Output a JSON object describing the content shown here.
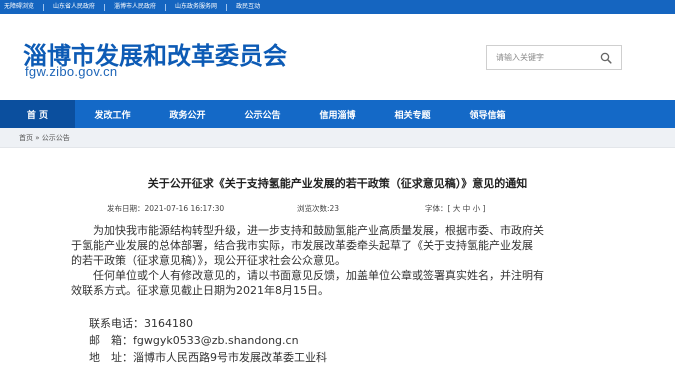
{
  "topbar": {
    "links": [
      "无障碍浏览",
      "山东省人民政府",
      "淄博市人民政府",
      "山东政务服务网",
      "政民互动"
    ]
  },
  "header": {
    "title": "淄博市发展和改革委员会",
    "domain": "fgw.zibo.gov.cn",
    "search_placeholder": "请输入关键字"
  },
  "nav": {
    "items": [
      "首 页",
      "发改工作",
      "政务公开",
      "公示公告",
      "信用淄博",
      "相关专题",
      "领导信箱"
    ],
    "active_index": 0
  },
  "breadcrumb": "首页 » 公示公告",
  "article": {
    "title": "关于公开征求《关于支持氢能产业发展的若干政策（征求意见稿）》意见的通知",
    "publish_time": "发布日期：2021-07-16 16:17:30",
    "views": "浏览次数:23",
    "font_size_label": "字体：",
    "size_big": "大",
    "size_mid": "中",
    "size_small": "小",
    "para1_line1": "为加快我市能源结构转型升级，进一步支持和鼓励氢能产业高质量发展，根据市委、市政府关",
    "para1_line2": "于氢能产业发展的总体部署，结合我市实际，市发展改革委牵头起草了《关于支持氢能产业发展",
    "para1_line3": "的若干政策（征求意见稿）》，现公开征求社会公众意见。",
    "para2_line1": "任何单位或个人有修改意见的，请以书面意见反馈，加盖单位公章或签署真实姓名，并注明有",
    "para2_line2": "效联系方式。征求意见截止日期为2021年8月15日。",
    "phone_label": "联系电话：",
    "phone": "3164180",
    "email_label": "邮　箱：",
    "email": "fgwgyk0533@zb.shandong.cn",
    "address_label": "地　址：",
    "address": "淄博市人民西路9号市发展改革委工业科"
  }
}
